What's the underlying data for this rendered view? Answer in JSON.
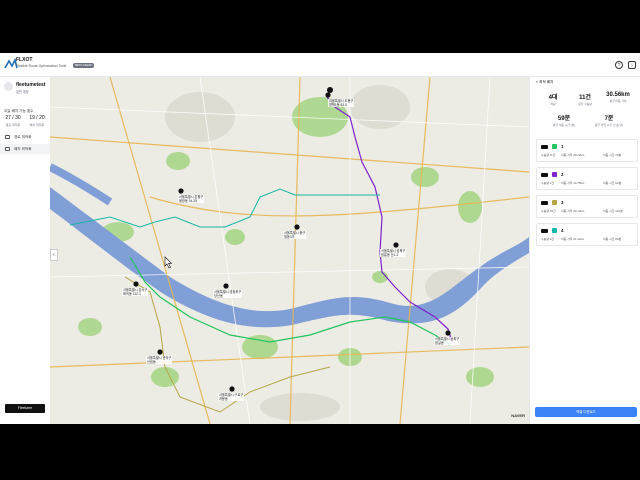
{
  "header": {
    "brand": "FLXOT",
    "subtitle": "Flexible Route Optimization Tools",
    "badge": "BETA DEMO",
    "help_icon": "question-circle-icon",
    "menu_icon": "sidebar-toggle-icon"
  },
  "user": {
    "name": "fleetumetest",
    "role": "일반 계정"
  },
  "quota": {
    "title": "오늘 배차 가능 횟수",
    "items": [
      {
        "value": "27 / 30",
        "label": "경로 최적화"
      },
      {
        "value": "19 / 20",
        "label": "배차 최적화"
      }
    ]
  },
  "nav": [
    {
      "label": "경로 최적화",
      "icon": "route-icon",
      "active": false
    },
    {
      "label": "배차 최적화",
      "icon": "truck-icon",
      "active": true
    }
  ],
  "left_footer_button": "Fleetume",
  "map": {
    "provider": "NAVER",
    "labels": [
      {
        "text": "서울특별시 도봉구\n방학1동 63-5"
      },
      {
        "text": "서울특별시 은평구\n불광동 34-25"
      },
      {
        "text": "서울특별시 성북구\n정릉동 산1-1"
      },
      {
        "text": "서울특별시 중구\n필동3가"
      },
      {
        "text": "서울특별시 강서구\n화곡동 122-1"
      },
      {
        "text": "서울특별시 영등포구\n당산동"
      },
      {
        "text": "서울특별시 관악구\n신림동"
      },
      {
        "text": "서울특별시 구로구\n개봉동"
      },
      {
        "text": "서울특별시 송파구\n잠실동"
      }
    ],
    "colors": {
      "route1": "#22c55e",
      "route2": "#7e22ce",
      "route3": "#b5a642",
      "route4": "#14b8a6",
      "water": "#7f9fd6",
      "park": "#9fd07a"
    }
  },
  "right_panel": {
    "back_label": "< 최적 배차",
    "summary": [
      {
        "value": "4대",
        "label": "차량"
      },
      {
        "value": "11건",
        "label": "정산 수송량"
      },
      {
        "value": "30.56km",
        "label": "평균 이동 거리"
      },
      {
        "value": "59분",
        "label": "평균 이동 시간 (분)"
      },
      {
        "value": "7분",
        "label": "평균 작업 시간 (수송 당)"
      }
    ],
    "vehicles": [
      {
        "id": "1",
        "color": "#22c55e",
        "a": "수송량 11건",
        "b": "이동 거리 20.22km",
        "c": "이동 시간 79분"
      },
      {
        "id": "2",
        "color": "#7e22ce",
        "a": "수송량 2건",
        "b": "이동 거리 10.75km",
        "c": "이동 시간 62분"
      },
      {
        "id": "3",
        "color": "#b5a642",
        "a": "수송량 15건",
        "b": "이동 거리 30.13km",
        "c": "이동 시간 142분"
      },
      {
        "id": "4",
        "color": "#14b8a6",
        "a": "수송량 9건",
        "b": "이동 거리 21.11km",
        "c": "이동 시간 84분"
      }
    ],
    "download_button": "엑셀 다운로드"
  }
}
